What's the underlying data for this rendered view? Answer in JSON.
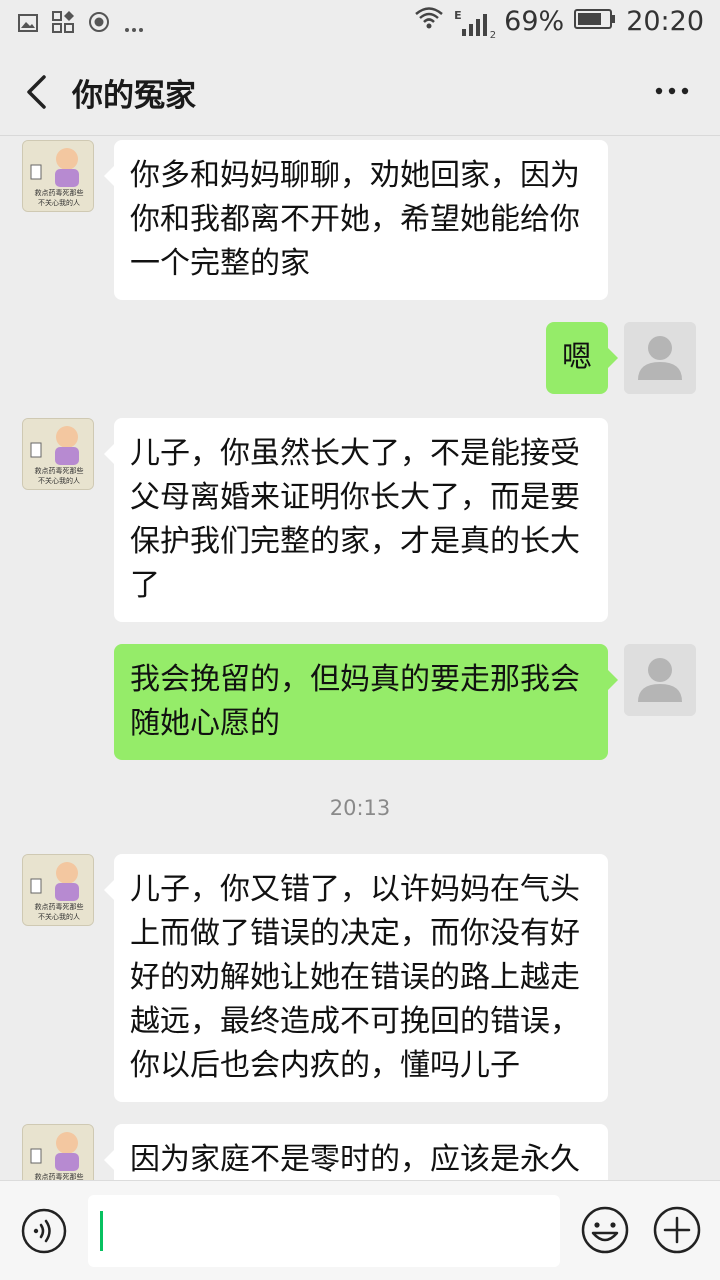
{
  "status_bar": {
    "battery_percent": "69%",
    "time": "20:20",
    "network_label": "E",
    "sim_index": "2"
  },
  "header": {
    "title": "你的冤家"
  },
  "messages": [
    {
      "side": "left",
      "text_lines": [
        "你多和妈妈聊聊，劝她回家，因为",
        "你和我都离不开她，希望她能给你",
        "一个完整的家"
      ]
    },
    {
      "side": "right",
      "text_lines": [
        "嗯"
      ]
    },
    {
      "side": "left",
      "text_lines": [
        "儿子，你虽然长大了，不是能接受",
        "父母离婚来证明你长大了，而是要",
        "保护我们完整的家，才是真的长大",
        "了"
      ]
    },
    {
      "side": "right",
      "text_lines": [
        "我会挽留的，但妈真的要走那我会",
        "随她心愿的"
      ]
    },
    {
      "side": "timestamp",
      "text": "20:13"
    },
    {
      "side": "left",
      "text_lines": [
        "儿子，你又错了，以许妈妈在气头",
        "上而做了错误的决定，而你没有好",
        "好的劝解她让她在错误的路上越走",
        "越远，最终造成不可挽回的错误，",
        "你以后也会内疚的，懂吗儿子"
      ]
    },
    {
      "side": "left",
      "text_lines": [
        "因为家庭不是零时的，应该是永久"
      ]
    }
  ],
  "avatar_caption": [
    "救点药毒死那些",
    "不关心我的人"
  ],
  "input": {
    "value": "",
    "placeholder": ""
  },
  "colors": {
    "background": "#ededed",
    "bubble_self": "#95ec69",
    "bubble_other": "#ffffff",
    "caret": "#07c160"
  },
  "icons": [
    "back-arrow-icon",
    "more-icon",
    "voice-icon",
    "emoji-icon",
    "plus-icon"
  ]
}
